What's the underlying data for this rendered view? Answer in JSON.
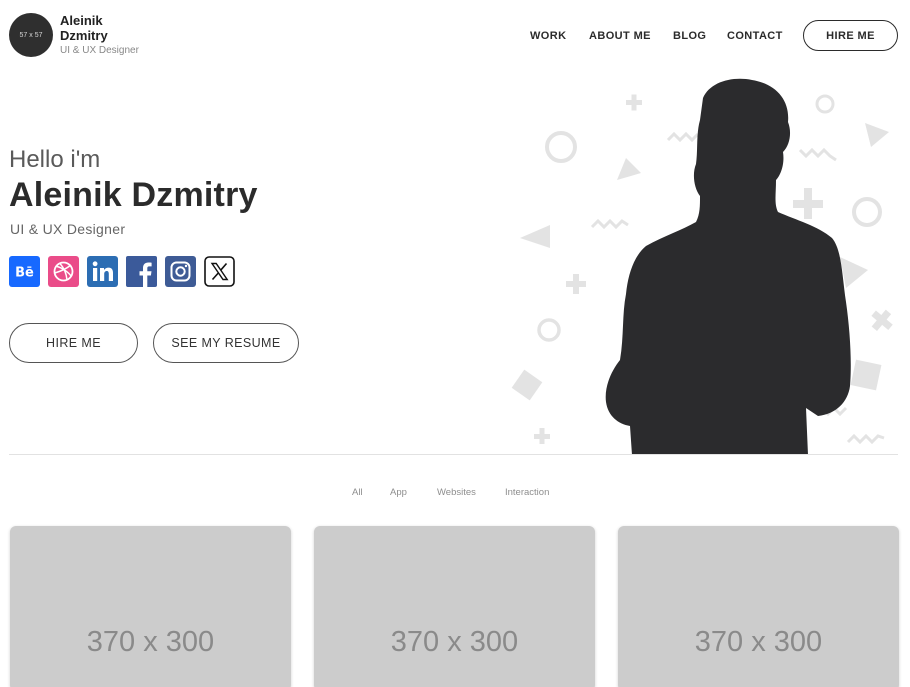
{
  "header": {
    "avatar_text": "57 x 57",
    "brand_name": "Aleinik Dzmitry",
    "brand_subtitle": "UI & UX Designer",
    "nav": [
      {
        "label": "WORK"
      },
      {
        "label": "ABOUT ME"
      },
      {
        "label": "BLOG"
      },
      {
        "label": "CONTACT"
      }
    ],
    "hire_button": "HIRE ME"
  },
  "hero": {
    "greeting": "Hello i'm",
    "name": "Aleinik Dzmitry",
    "role": "UI & UX Designer",
    "socials": [
      {
        "icon": "behance-icon",
        "color": "#1769ff"
      },
      {
        "icon": "dribbble-icon",
        "color": "#ea4c89"
      },
      {
        "icon": "linkedin-icon",
        "color": "#2c6db3"
      },
      {
        "icon": "facebook-icon",
        "color": "#3b5a9a"
      },
      {
        "icon": "instagram-icon",
        "color": "#3e5b95"
      },
      {
        "icon": "x-icon",
        "color": "#000000"
      }
    ],
    "hire_button": "HIRE ME",
    "resume_button": "SEE MY RESUME"
  },
  "filters": [
    "All",
    "App",
    "Websites",
    "Interaction"
  ],
  "portfolio": [
    {
      "placeholder": "370 x 300"
    },
    {
      "placeholder": "370 x 300"
    },
    {
      "placeholder": "370 x 300"
    }
  ],
  "colors": {
    "text_dark": "#2b2b2b",
    "silhouette": "#2b2b2d",
    "decor": "#e3e3e3",
    "card_bg": "#cccccc"
  }
}
